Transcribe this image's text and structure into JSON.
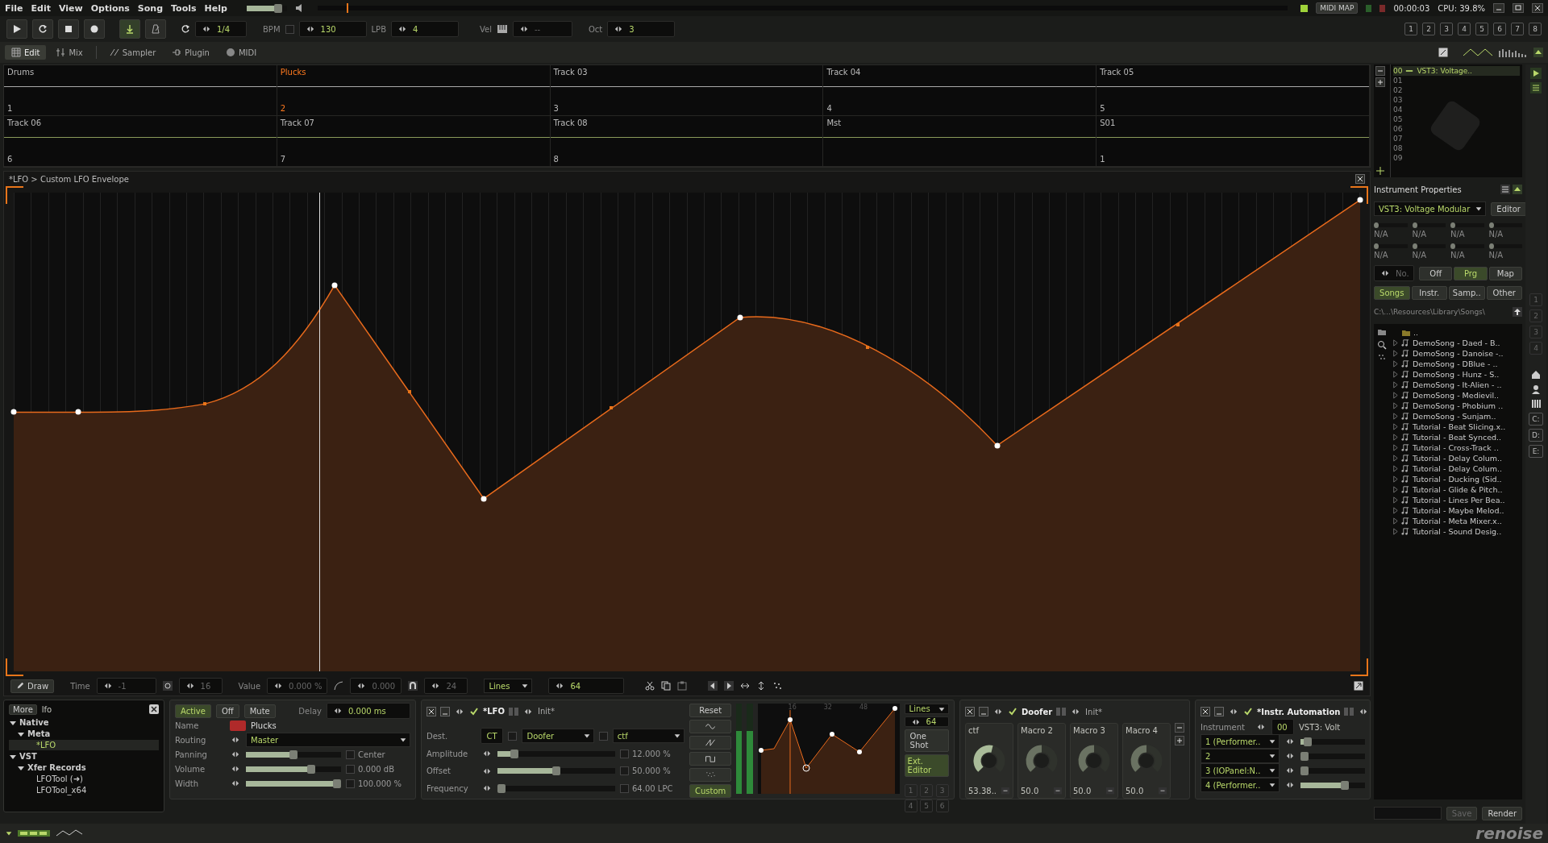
{
  "menu": [
    "File",
    "Edit",
    "View",
    "Options",
    "Song",
    "Tools",
    "Help"
  ],
  "master_volume": {
    "level": 0.85
  },
  "song_position": {
    "level": 0.03
  },
  "status": {
    "midi_map": "MIDI MAP",
    "time": "00:00:03",
    "cpu": "CPU: 39.8%"
  },
  "transport": {
    "lines": "1/4",
    "bpm_label": "BPM",
    "bpm_checked": false,
    "bpm": "130",
    "lpb_label": "LPB",
    "lpb": "4",
    "vel_label": "Vel",
    "vel": "--",
    "oct_label": "Oct",
    "oct": "3"
  },
  "track_numbers": [
    "1",
    "2",
    "3",
    "4",
    "5",
    "6",
    "7",
    "8"
  ],
  "tabs": [
    {
      "label": "Edit",
      "selected": true
    },
    {
      "label": "Mix",
      "selected": false
    },
    {
      "label": "Sampler",
      "selected": false
    },
    {
      "label": "Plugin",
      "selected": false
    },
    {
      "label": "MIDI",
      "selected": false
    }
  ],
  "tracks": [
    {
      "name": "Drums",
      "number": "1",
      "selected": false
    },
    {
      "name": "Plucks",
      "number": "2",
      "selected": true
    },
    {
      "name": "Track 03",
      "number": "3",
      "selected": false
    },
    {
      "name": "Track 04",
      "number": "4",
      "selected": false
    },
    {
      "name": "Track 05",
      "number": "5",
      "selected": false
    },
    {
      "name": "Track 06",
      "number": "6",
      "selected": false
    },
    {
      "name": "Track 07",
      "number": "7",
      "selected": false
    },
    {
      "name": "Track 08",
      "number": "8",
      "selected": false
    },
    {
      "name": "Mst",
      "selected": false
    },
    {
      "name": "S01",
      "number": "1",
      "selected": false
    }
  ],
  "envelope": {
    "title": "*LFO > Custom LFO Envelope"
  },
  "env_toolbar": {
    "draw": "Draw",
    "time_label": "Time",
    "time": "-1",
    "snap": "16",
    "value_label": "Value",
    "value": "0.000 %",
    "curve": "0.000",
    "quant": "24",
    "mode": "Lines",
    "length": "64"
  },
  "browser": {
    "more": "More",
    "search": "lfo",
    "tree": [
      {
        "label": "Native",
        "expanded": true,
        "selected": false,
        "children": [
          {
            "label": "Meta",
            "expanded": true,
            "selected": false,
            "children": [
              {
                "label": "*LFO",
                "selected": true
              }
            ]
          }
        ]
      },
      {
        "label": "VST",
        "expanded": true,
        "selected": false,
        "children": [
          {
            "label": "Xfer Records",
            "expanded": true,
            "selected": false,
            "children": [
              {
                "label": "LFOTool (➜)",
                "selected": false
              },
              {
                "label": "LFOTool_x64",
                "selected": false
              }
            ]
          }
        ]
      }
    ]
  },
  "track_device": {
    "buttons": [
      {
        "label": "Active",
        "selected": true
      },
      {
        "label": "Off",
        "selected": false
      },
      {
        "label": "Mute",
        "selected": false
      }
    ],
    "delay_label": "Delay",
    "delay": "0.000 ms",
    "name_label": "Name",
    "name": "Plucks",
    "rows": [
      {
        "label": "Routing",
        "kind": "select",
        "value": "Master"
      },
      {
        "label": "Panning",
        "kind": "slider",
        "level": 0.5,
        "checked": false,
        "reading": "Center"
      },
      {
        "label": "Volume",
        "kind": "slider",
        "level": 0.7,
        "checked": false,
        "reading": "0.000 dB"
      },
      {
        "label": "Width",
        "kind": "slider",
        "level": 1.0,
        "checked": false,
        "reading": "100.000 %"
      }
    ]
  },
  "lfo_device": {
    "title": "*LFO",
    "preset": "Init*",
    "dest_label": "Dest.",
    "dest_tag": "CT",
    "dest_device_checked": false,
    "dest_device": "Doofer",
    "dest_param_checked": false,
    "dest_param": "ctf",
    "reset": "Reset",
    "params": [
      {
        "label": "Amplitude",
        "level": 0.12,
        "checked": false,
        "reading": "12.000 %"
      },
      {
        "label": "Offset",
        "level": 0.5,
        "checked": false,
        "reading": "50.000 %"
      },
      {
        "label": "Frequency",
        "level": 0,
        "checked": false,
        "reading": "64.00 LPC"
      }
    ],
    "shapes": [
      {
        "kind": "sine",
        "selected": false
      },
      {
        "kind": "saw",
        "selected": false
      },
      {
        "kind": "square",
        "selected": false
      },
      {
        "kind": "random",
        "selected": false
      },
      {
        "kind": "custom",
        "label": "Custom",
        "selected": true
      }
    ]
  },
  "mini_envelope": {
    "ruler": [
      "16",
      "32",
      "48"
    ],
    "mode": "Lines",
    "length": "64",
    "one_shot": "One Shot",
    "ext_editor": "Ext. Editor",
    "presets": [
      "1",
      "2",
      "3",
      "4",
      "5",
      "6"
    ]
  },
  "doofer": {
    "title": "Doofer",
    "preset": "Init*",
    "macros": [
      {
        "label": "ctf",
        "level": 0.55,
        "reading": "53.38..",
        "mapped": true
      },
      {
        "label": "Macro 2",
        "level": 0.5,
        "reading": "50.0",
        "mapped": false
      },
      {
        "label": "Macro 3",
        "level": 0.5,
        "reading": "50.0",
        "mapped": false
      },
      {
        "label": "Macro 4",
        "level": 0.5,
        "reading": "50.0",
        "mapped": false
      }
    ]
  },
  "automation": {
    "title": "*Instr. Automation",
    "instrument_label": "Instrument",
    "instrument_index": "00",
    "instrument_name": "VST3: Volt",
    "params": [
      {
        "name": "1 (Performer..",
        "level": 0.05
      },
      {
        "name": "2",
        "level": 0
      },
      {
        "name": "3 (IOPanel:N..",
        "level": 0
      },
      {
        "name": "4 (Performer..",
        "level": 0.72
      }
    ]
  },
  "instrument_list": {
    "slots": [
      {
        "index": "00",
        "name": "VST3: Voltage..",
        "selected": true
      },
      {
        "index": "01",
        "selected": false
      },
      {
        "index": "02",
        "selected": false
      },
      {
        "index": "03",
        "selected": false
      },
      {
        "index": "04",
        "selected": false
      },
      {
        "index": "05",
        "selected": false
      },
      {
        "index": "06",
        "selected": false
      },
      {
        "index": "07",
        "selected": false
      },
      {
        "index": "08",
        "selected": false
      },
      {
        "index": "09",
        "selected": false
      }
    ]
  },
  "instrument_properties": {
    "title": "Instrument Properties",
    "plugin": "VST3: Voltage Modular",
    "editor": "Editor",
    "params": [
      {
        "level": 0,
        "reading": "N/A"
      },
      {
        "level": 0,
        "reading": "N/A"
      },
      {
        "level": 0,
        "reading": "N/A"
      },
      {
        "level": 0,
        "reading": "N/A"
      },
      {
        "level": 0,
        "reading": "N/A"
      },
      {
        "level": 0,
        "reading": "N/A"
      },
      {
        "level": 0,
        "reading": "N/A"
      },
      {
        "level": 0,
        "reading": "N/A"
      }
    ],
    "program": "No.",
    "modes": [
      {
        "label": "Off",
        "selected": false
      },
      {
        "label": "Prg",
        "selected": true
      },
      {
        "label": "Map",
        "selected": false
      }
    ]
  },
  "disk_browser": {
    "tabs": [
      {
        "label": "Songs",
        "selected": true
      },
      {
        "label": "Instr.",
        "selected": false
      },
      {
        "label": "Samp..",
        "selected": false
      },
      {
        "label": "Other",
        "selected": false
      }
    ],
    "path": "C:\\...\\Resources\\Library\\Songs\\",
    "parent": "..",
    "files": [
      "DemoSong - Daed - B..",
      "DemoSong - Danoise -..",
      "DemoSong - DBlue - ..",
      "DemoSong - Hunz - S..",
      "DemoSong - It-Alien - ..",
      "DemoSong - Medievil..",
      "DemoSong - Phobium ..",
      "DemoSong - Sunjam..",
      "Tutorial - Beat Slicing.x..",
      "Tutorial - Beat Synced..",
      "Tutorial - Cross-Track ..",
      "Tutorial - Delay Colum..",
      "Tutorial - Delay Colum..",
      "Tutorial - Ducking (Sid..",
      "Tutorial - Glide & Pitch..",
      "Tutorial - Lines Per Bea..",
      "Tutorial - Maybe Melod..",
      "Tutorial - Meta Mixer.x..",
      "Tutorial - Sound Desig.."
    ],
    "save": "Save",
    "render": "Render"
  },
  "side_strip": {
    "numbers": [
      "1",
      "2",
      "3",
      "4"
    ],
    "drives": [
      "C:",
      "D:",
      "E:"
    ]
  },
  "footer": {
    "logo": "renoise"
  }
}
